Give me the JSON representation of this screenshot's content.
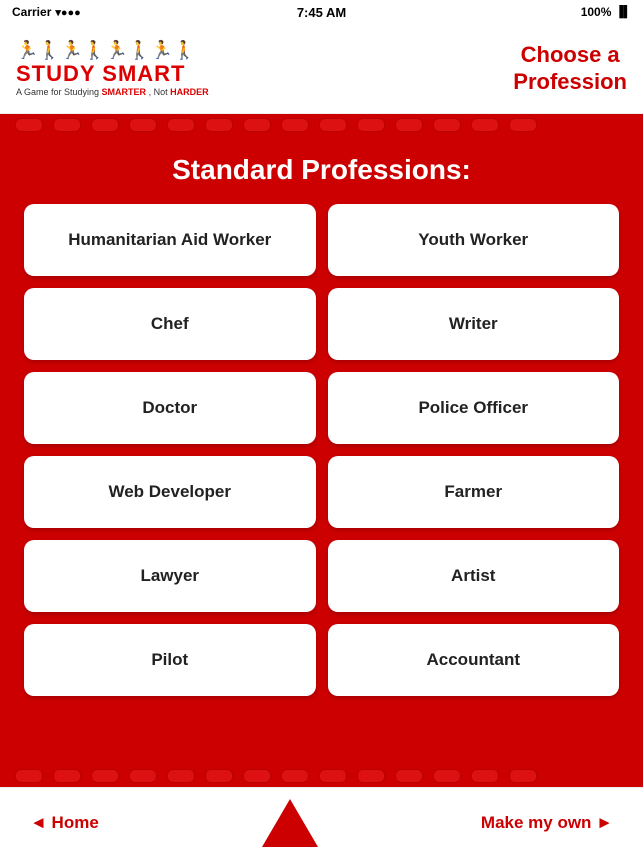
{
  "statusBar": {
    "carrier": "Carrier",
    "time": "7:45 AM",
    "battery": "100%"
  },
  "header": {
    "logoTitle": "STUDY SMART",
    "logoSubtitle": "A Game for Studying SMARTER, Not HARDER",
    "pageTitle": "Choose a\nProfession"
  },
  "main": {
    "sectionTitle": "Standard Professions:",
    "professions": [
      {
        "id": "humanitarian-aid-worker",
        "label": "Humanitarian Aid Worker"
      },
      {
        "id": "youth-worker",
        "label": "Youth Worker"
      },
      {
        "id": "chef",
        "label": "Chef"
      },
      {
        "id": "writer",
        "label": "Writer"
      },
      {
        "id": "doctor",
        "label": "Doctor"
      },
      {
        "id": "police-officer",
        "label": "Police Officer"
      },
      {
        "id": "web-developer",
        "label": "Web Developer"
      },
      {
        "id": "farmer",
        "label": "Farmer"
      },
      {
        "id": "lawyer",
        "label": "Lawyer"
      },
      {
        "id": "artist",
        "label": "Artist"
      },
      {
        "id": "pilot",
        "label": "Pilot"
      },
      {
        "id": "accountant",
        "label": "Accountant"
      }
    ]
  },
  "footer": {
    "homeLabel": "◄ Home",
    "makeOwnLabel": "Make my own ►"
  }
}
